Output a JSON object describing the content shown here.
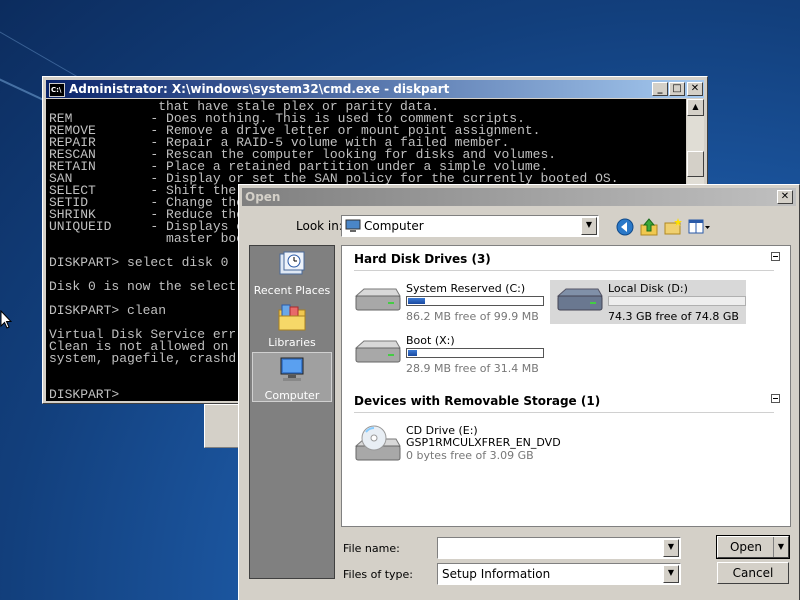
{
  "cmd": {
    "title": "Administrator: X:\\windows\\system32\\cmd.exe - diskpart",
    "buttons": {
      "minimize": "_",
      "maximize": "□",
      "close": "✕"
    },
    "lines": [
      "              that have stale plex or parity data.",
      "REM          - Does nothing. This is used to comment scripts.",
      "REMOVE       - Remove a drive letter or mount point assignment.",
      "REPAIR       - Repair a RAID-5 volume with a failed member.",
      "RESCAN       - Rescan the computer looking for disks and volumes.",
      "RETAIN       - Place a retained partition under a simple volume.",
      "SAN          - Display or set the SAN policy for the currently booted OS.",
      "SELECT       - Shift the",
      "SETID        - Change the",
      "SHRINK       - Reduce the",
      "UNIQUEID     - Displays o",
      "               master boo",
      "",
      "DISKPART> select disk 0",
      "",
      "Disk 0 is now the select",
      "",
      "DISKPART> clean",
      "",
      "Virtual Disk Service err",
      "Clean is not allowed on",
      "system, pagefile, crashd",
      "",
      "",
      "DISKPART>"
    ]
  },
  "dialog": {
    "title": "Open",
    "close": "✕",
    "look_in_label": "Look in:",
    "look_in_value": "Computer",
    "toolbar_icons": [
      "back-icon",
      "up-folder-icon",
      "new-folder-icon",
      "views-menu-icon"
    ],
    "places": [
      {
        "label": "Recent Places",
        "icon": "recent-places-icon"
      },
      {
        "label": "Libraries",
        "icon": "libraries-icon"
      },
      {
        "label": "Computer",
        "icon": "computer-icon",
        "selected": true
      }
    ],
    "groups": {
      "hdd": {
        "title": "Hard Disk Drives (3)",
        "items": [
          {
            "name": "System Reserved (C:)",
            "free": "86.2 MB free of 99.9 MB",
            "used_fraction": 0.14,
            "selected": false
          },
          {
            "name": "Local Disk (D:)",
            "free": "74.3 GB free of 74.8 GB",
            "used_fraction": 0.01,
            "selected": true
          },
          {
            "name": "Boot (X:)",
            "free": "28.9 MB free of 31.4 MB",
            "used_fraction": 0.08,
            "selected": false
          }
        ]
      },
      "removable": {
        "title": "Devices with Removable Storage (1)",
        "items": [
          {
            "name": "CD Drive (E:)",
            "label": "GSP1RMCULXFRER_EN_DVD",
            "free": "0 bytes free of 3.09 GB"
          }
        ]
      }
    },
    "file_name_label": "File name:",
    "file_name_value": "",
    "files_of_type_label": "Files of type:",
    "files_of_type_value": "Setup Information",
    "open_label": "Open",
    "cancel_label": "Cancel"
  }
}
